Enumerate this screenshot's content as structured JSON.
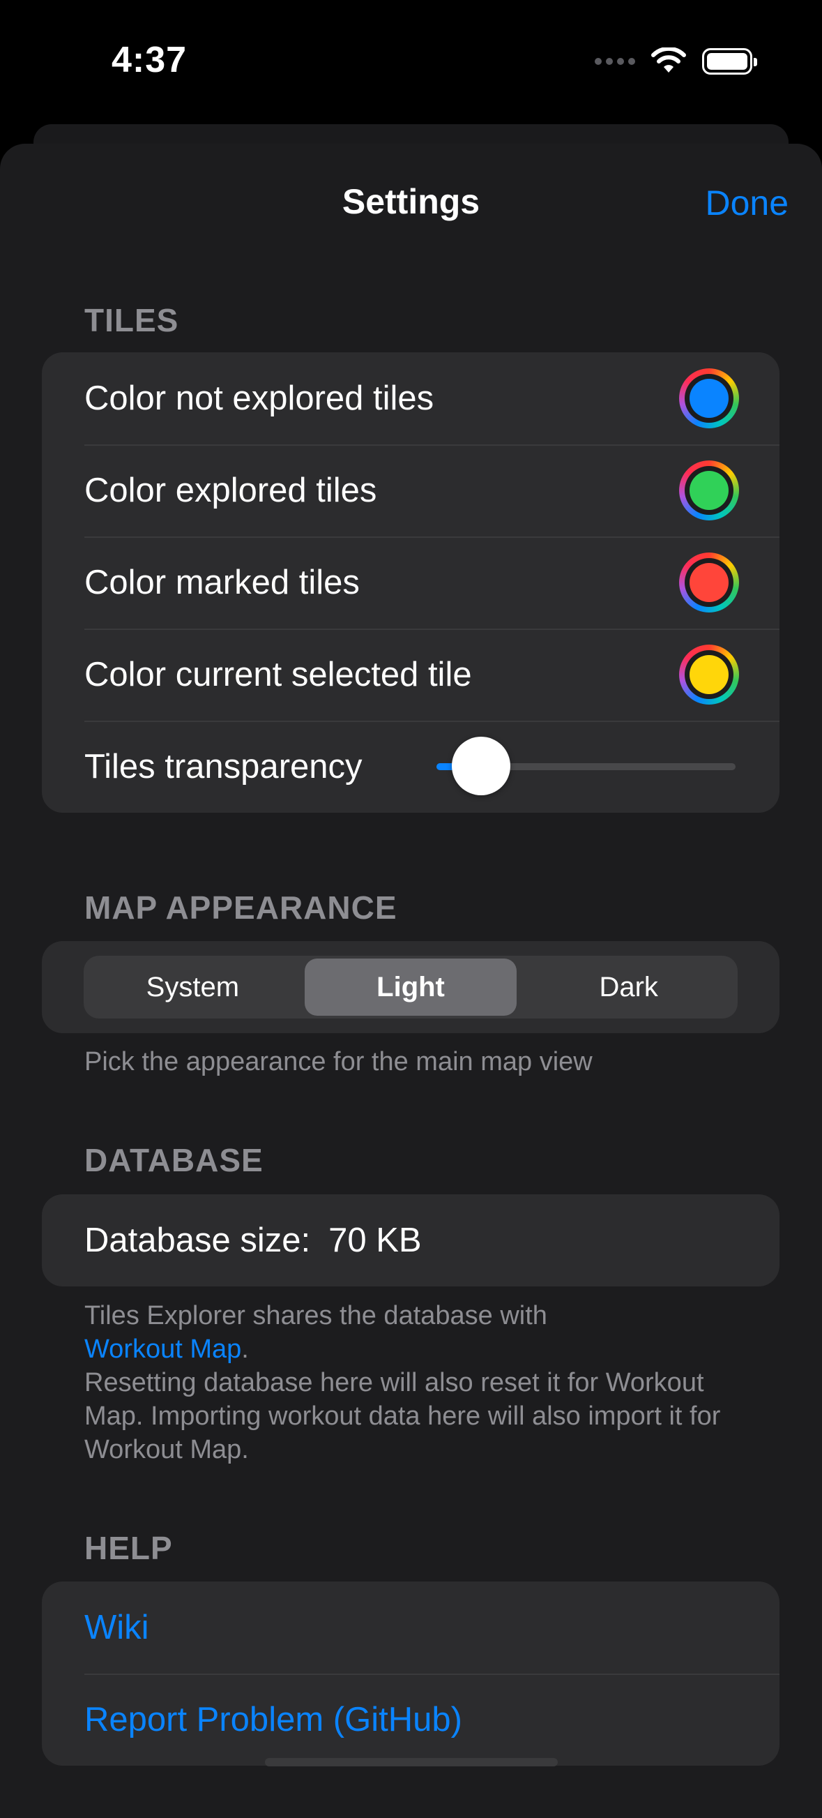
{
  "status_bar": {
    "time": "4:37"
  },
  "nav": {
    "title": "Settings",
    "done_label": "Done"
  },
  "tiles": {
    "header": "TILES",
    "rows": [
      {
        "label": "Color not explored tiles",
        "color": "#0a84ff"
      },
      {
        "label": "Color explored tiles",
        "color": "#30d158"
      },
      {
        "label": "Color marked tiles",
        "color": "#ff453a"
      },
      {
        "label": "Color current selected tile",
        "color": "#ffd60a"
      }
    ],
    "transparency_label": "Tiles transparency",
    "transparency_value": 0.15
  },
  "map_appearance": {
    "header": "MAP APPEARANCE",
    "options": [
      "System",
      "Light",
      "Dark"
    ],
    "selected": "Light",
    "footer": "Pick the appearance for the main map view"
  },
  "database": {
    "header": "DATABASE",
    "size_label": "Database size:",
    "size_value": "70 KB",
    "footer_prefix": "Tiles Explorer shares the database with",
    "footer_link": "Workout Map",
    "footer_period": ".",
    "footer_rest": "Resetting database here will also reset it for Workout Map. Importing workout data here will also import it for Workout Map."
  },
  "help": {
    "header": "HELP",
    "wiki_label": "Wiki",
    "report_label": "Report Problem (GitHub)"
  },
  "colors": {
    "accent": "#0a84ff",
    "background": "#1c1c1e",
    "cell": "#2c2c2e"
  }
}
